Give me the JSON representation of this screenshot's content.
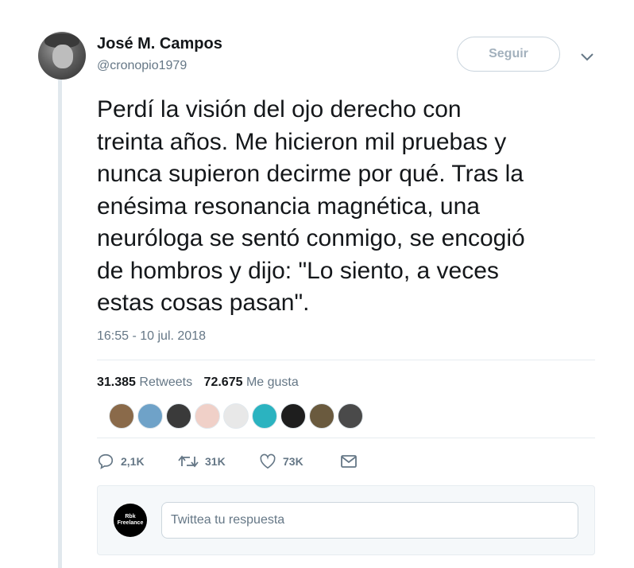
{
  "author": {
    "display_name": "José M. Campos",
    "handle": "@cronopio1979"
  },
  "follow_button": {
    "label": "Seguir"
  },
  "tweet": {
    "text": "Perdí la visión del ojo derecho con\ntreinta años. Me hicieron mil pruebas y\nnunca supieron decirme por qué. Tras la\nenésima resonancia magnética, una\nneuróloga se sentó conmigo, se encogió\nde hombros y dijo: \"Lo siento, a veces\nestas cosas pasan\".",
    "timestamp": "16:55 - 10 jul. 2018"
  },
  "stats": {
    "retweets_count": "31.385",
    "retweets_label": "Retweets",
    "likes_count": "72.675",
    "likes_label": "Me gusta"
  },
  "likers": [
    {
      "color": "#8a6a4a"
    },
    {
      "color": "#6fa2c8"
    },
    {
      "color": "#3a3a3a"
    },
    {
      "color": "#f0d0c8"
    },
    {
      "color": "#e8e8e8"
    },
    {
      "color": "#2bb3c0"
    },
    {
      "color": "#1e1e1e"
    },
    {
      "color": "#6a5a3e"
    },
    {
      "color": "#4a4a4a"
    }
  ],
  "actions": {
    "replies": "2,1K",
    "retweets": "31K",
    "likes": "73K"
  },
  "reply": {
    "avatar_line1": "Rbk",
    "avatar_line2": "Freelance",
    "placeholder": "Twittea tu respuesta"
  },
  "colors": {
    "text_primary": "#14171a",
    "text_secondary": "#657786",
    "border": "#e6ecf0",
    "thread_line": "#e1e8ed"
  }
}
